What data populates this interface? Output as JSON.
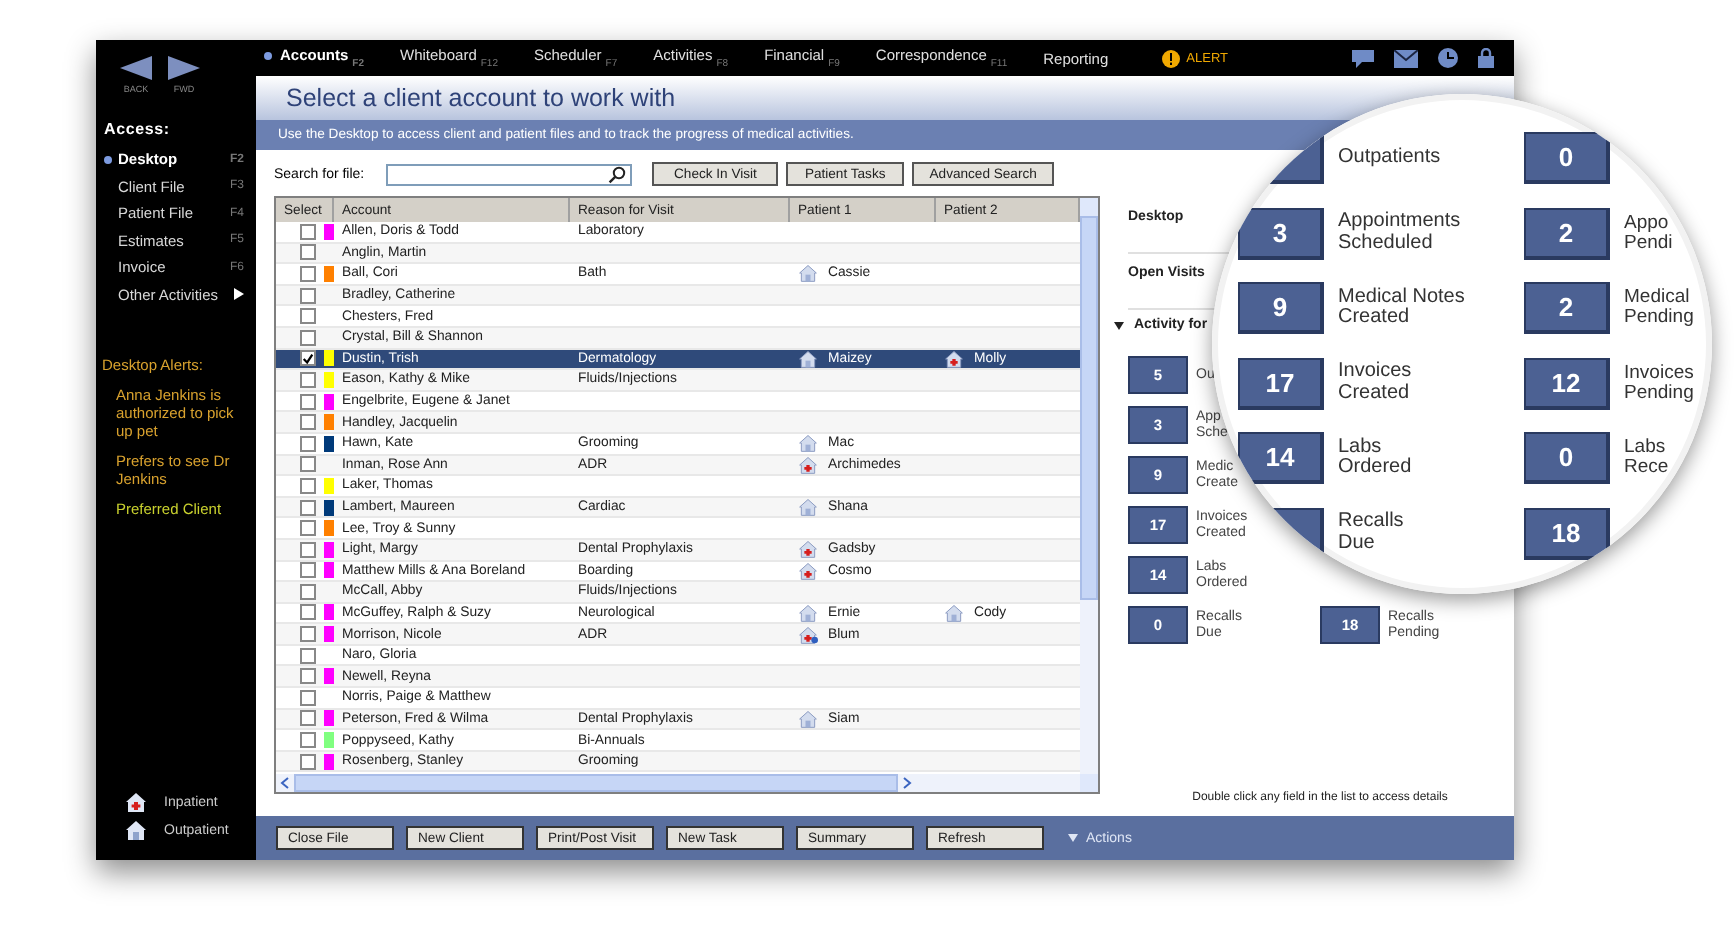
{
  "nav": {
    "back": "BACK",
    "forward": "FWD"
  },
  "sidebar": {
    "heading": "Access:",
    "items": [
      {
        "label": "Desktop",
        "key": "F2",
        "selected": true,
        "submenu": false
      },
      {
        "label": "Client File",
        "key": "F3",
        "selected": false,
        "submenu": false
      },
      {
        "label": "Patient File",
        "key": "F4",
        "selected": false,
        "submenu": false
      },
      {
        "label": "Estimates",
        "key": "F5",
        "selected": false,
        "submenu": false
      },
      {
        "label": "Invoice",
        "key": "F6",
        "selected": false,
        "submenu": false
      },
      {
        "label": "Other Activities",
        "selected": false,
        "submenu": true
      }
    ],
    "alerts_heading": "Desktop Alerts:",
    "alerts": [
      {
        "text": "Anna Jenkins is authorized to pick up pet",
        "color": "#d9a22e"
      },
      {
        "text": "Prefers to see Dr Jenkins",
        "color": "#d9a22e"
      },
      {
        "text": "Preferred Client",
        "color": "#c9d12e"
      }
    ],
    "shortcuts": [
      {
        "label": "Inpatient",
        "kind": "inpatient"
      },
      {
        "label": "Outpatient",
        "kind": "outpatient"
      }
    ]
  },
  "menu": [
    {
      "label": "Accounts",
      "key": "F2",
      "selected": true
    },
    {
      "label": "Whiteboard",
      "key": "F12",
      "selected": false
    },
    {
      "label": "Scheduler",
      "key": "F7",
      "selected": false
    },
    {
      "label": "Activities",
      "key": "F8",
      "selected": false
    },
    {
      "label": "Financial",
      "key": "F9",
      "selected": false
    },
    {
      "label": "Correspondence",
      "key": "F11",
      "selected": false
    },
    {
      "label": "Reporting",
      "selected": false
    }
  ],
  "alert": "ALERT",
  "title": "Select a client account to work with",
  "banner": "Use the Desktop to access client and patient files and to track the progress of medical activities.",
  "search": {
    "label": "Search for file:"
  },
  "search_buttons": [
    "Check In Visit",
    "Patient Tasks",
    "Advanced Search"
  ],
  "table": {
    "columns": [
      "Select",
      "Account",
      "Reason for Visit",
      "Patient 1",
      "Patient 2"
    ],
    "rows": [
      {
        "account": "Allen, Doris & Todd",
        "reason": "Laboratory",
        "color": "#ff00ff",
        "checked": false,
        "selected": false,
        "patients": []
      },
      {
        "account": "Anglin, Martin",
        "checked": false,
        "selected": false,
        "patients": []
      },
      {
        "account": "Ball, Cori",
        "reason": "Bath",
        "color": "#ff8000",
        "checked": false,
        "selected": false,
        "patients": [
          {
            "name": "Cassie",
            "kind": "outpatient"
          }
        ]
      },
      {
        "account": "Bradley, Catherine",
        "checked": false,
        "selected": false,
        "patients": []
      },
      {
        "account": "Chesters, Fred",
        "checked": false,
        "selected": false,
        "patients": []
      },
      {
        "account": "Crystal, Bill & Shannon",
        "checked": false,
        "selected": false,
        "patients": []
      },
      {
        "account": "Dustin, Trish",
        "reason": "Dermatology",
        "color": "#ffff00",
        "checked": true,
        "selected": true,
        "patients": [
          {
            "name": "Maizey",
            "kind": "outpatient"
          },
          {
            "name": "Molly",
            "kind": "inpatient"
          }
        ]
      },
      {
        "account": "Eason, Kathy & Mike",
        "reason": "Fluids/Injections",
        "color": "#ffff00",
        "checked": false,
        "selected": false,
        "patients": []
      },
      {
        "account": "Engelbrite, Eugene & Janet",
        "color": "#ff00ff",
        "checked": false,
        "selected": false,
        "patients": []
      },
      {
        "account": "Handley, Jacquelin",
        "color": "#ff8000",
        "checked": false,
        "selected": false,
        "patients": []
      },
      {
        "account": "Hawn, Kate",
        "reason": "Grooming",
        "color": "#003a7a",
        "checked": false,
        "selected": false,
        "patients": [
          {
            "name": "Mac",
            "kind": "outpatient"
          }
        ]
      },
      {
        "account": "Inman, Rose Ann",
        "reason": "ADR",
        "checked": false,
        "selected": false,
        "patients": [
          {
            "name": "Archimedes",
            "kind": "inpatient"
          }
        ]
      },
      {
        "account": "Laker, Thomas",
        "color": "#ffff00",
        "checked": false,
        "selected": false,
        "patients": []
      },
      {
        "account": "Lambert, Maureen",
        "reason": "Cardiac",
        "color": "#003a7a",
        "checked": false,
        "selected": false,
        "patients": [
          {
            "name": "Shana",
            "kind": "outpatient"
          }
        ]
      },
      {
        "account": "Lee, Troy & Sunny",
        "color": "#ff8000",
        "checked": false,
        "selected": false,
        "patients": []
      },
      {
        "account": "Light, Margy",
        "reason": "Dental Prophylaxis",
        "color": "#ff00ff",
        "checked": false,
        "selected": false,
        "patients": [
          {
            "name": "Gadsby",
            "kind": "inpatient"
          }
        ]
      },
      {
        "account": "Matthew Mills & Ana Boreland",
        "reason": "Boarding",
        "color": "#ff00ff",
        "checked": false,
        "selected": false,
        "patients": [
          {
            "name": "Cosmo",
            "kind": "inpatient"
          }
        ]
      },
      {
        "account": "McCall, Abby",
        "reason": "Fluids/Injections",
        "checked": false,
        "selected": false,
        "patients": []
      },
      {
        "account": "McGuffey, Ralph & Suzy",
        "reason": "Neurological",
        "color": "#ff00ff",
        "checked": false,
        "selected": false,
        "patients": [
          {
            "name": "Ernie",
            "kind": "outpatient"
          },
          {
            "name": "Cody",
            "kind": "outpatient"
          }
        ]
      },
      {
        "account": "Morrison, Nicole",
        "reason": "ADR",
        "color": "#ff00ff",
        "checked": false,
        "selected": false,
        "patients": [
          {
            "name": "Blum",
            "kind": "inpatient-gear"
          }
        ]
      },
      {
        "account": "Naro, Gloria",
        "checked": false,
        "selected": false,
        "patients": []
      },
      {
        "account": "Newell, Reyna",
        "color": "#ff00ff",
        "checked": false,
        "selected": false,
        "patients": []
      },
      {
        "account": "Norris, Paige & Matthew",
        "checked": false,
        "selected": false,
        "patients": []
      },
      {
        "account": "Peterson, Fred & Wilma",
        "reason": "Dental Prophylaxis",
        "color": "#ff00ff",
        "checked": false,
        "selected": false,
        "patients": [
          {
            "name": "Siam",
            "kind": "outpatient"
          }
        ]
      },
      {
        "account": "Poppyseed, Kathy",
        "reason": "Bi-Annuals",
        "color": "#80ff80",
        "checked": false,
        "selected": false,
        "patients": []
      },
      {
        "account": "Rosenberg, Stanley",
        "reason": "Grooming",
        "color": "#ff00ff",
        "checked": false,
        "selected": false,
        "patients": []
      }
    ]
  },
  "panel": {
    "links": [
      "Desktop",
      "Open Visits"
    ],
    "activity_heading": "Activity for",
    "rows": [
      {
        "left": {
          "value": "5",
          "lines": [
            "Ou"
          ]
        }
      },
      {
        "left": {
          "value": "3",
          "lines": [
            "App",
            "Sche"
          ]
        }
      },
      {
        "left": {
          "value": "9",
          "lines": [
            "Medic",
            "Create"
          ]
        }
      },
      {
        "left": {
          "value": "17",
          "lines": [
            "Invoices",
            "Created"
          ]
        }
      },
      {
        "left": {
          "value": "14",
          "lines": [
            "Labs",
            "Ordered"
          ]
        }
      },
      {
        "left": {
          "value": "0",
          "lines": [
            "Recalls",
            "Due"
          ]
        },
        "right": {
          "value": "18",
          "lines": [
            "Recalls",
            "Pending"
          ]
        }
      }
    ],
    "hint": "Double click any field in the list to access details"
  },
  "magnifier": {
    "rows": [
      {
        "left": {
          "lines": [
            "Outpatients"
          ]
        },
        "right": {
          "value": "0"
        }
      },
      {
        "left": {
          "value": "3",
          "lines": [
            "Appointments",
            "Scheduled"
          ]
        },
        "right": {
          "value": "2",
          "lines": [
            "Appo",
            "Pendi"
          ]
        }
      },
      {
        "left": {
          "value": "9",
          "lines": [
            "Medical Notes",
            "Created"
          ]
        },
        "right": {
          "value": "2",
          "lines": [
            "Medical",
            "Pending"
          ]
        }
      },
      {
        "left": {
          "value": "17",
          "lines": [
            "Invoices",
            "Created"
          ]
        },
        "right": {
          "value": "12",
          "lines": [
            "Invoices",
            "Pending"
          ]
        }
      },
      {
        "left": {
          "value": "14",
          "lines": [
            "Labs",
            "Ordered"
          ]
        },
        "right": {
          "value": "0",
          "lines": [
            "Labs",
            "Rece"
          ]
        }
      },
      {
        "left": {
          "lines": [
            "Recalls",
            "Due"
          ]
        },
        "right": {
          "value": "18"
        }
      }
    ]
  },
  "bottom_buttons": [
    "Close File",
    "New Client",
    "Print/Post Visit",
    "New Task",
    "Summary",
    "Refresh"
  ],
  "actions_menu": "Actions"
}
